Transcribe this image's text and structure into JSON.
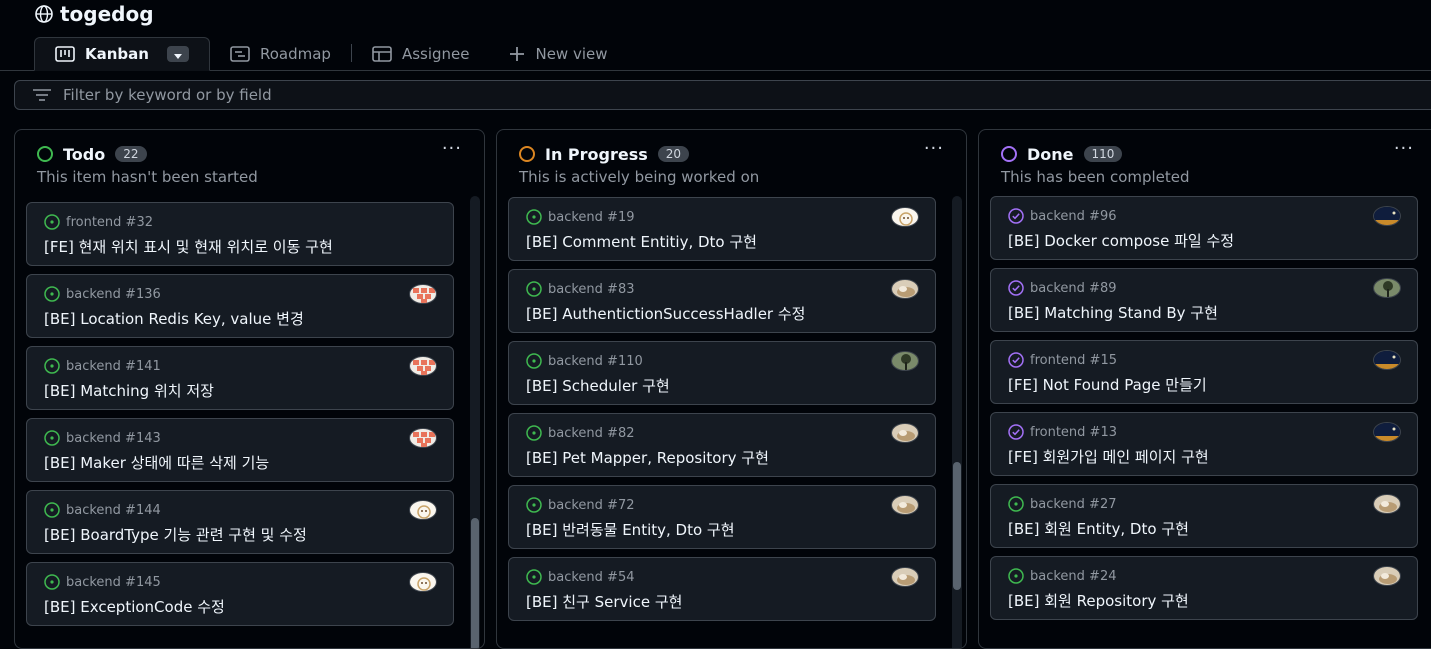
{
  "project": {
    "title": "togedog",
    "icon": "globe-icon"
  },
  "views": [
    {
      "label": "Kanban",
      "icon": "board-icon",
      "active": true
    },
    {
      "label": "Roadmap",
      "icon": "roadmap-icon",
      "active": false
    },
    {
      "label": "Assignee",
      "icon": "table-icon",
      "active": false
    },
    {
      "label": "New view",
      "icon": "plus-icon",
      "active": false
    }
  ],
  "filter": {
    "placeholder": "Filter by keyword or by field",
    "icon": "filter-icon"
  },
  "columns": [
    {
      "title": "Todo",
      "count": "22",
      "description": "This item hasn't been started",
      "status_color": "#3fb950",
      "menu": "···",
      "cards": [
        {
          "meta": "frontend #32",
          "title": "[FE] 현재 위치 표시 및 현재 위치로 이동 구현",
          "state": "open",
          "avatar": ""
        },
        {
          "meta": "backend #136",
          "title": "[BE] Location Redis Key, value 변경",
          "state": "open",
          "avatar": "pixel"
        },
        {
          "meta": "backend #141",
          "title": "[BE] Matching 위치 저장",
          "state": "open",
          "avatar": "pixel"
        },
        {
          "meta": "backend #143",
          "title": "[BE] Maker 상태에 따른 삭제 기능",
          "state": "open",
          "avatar": "pixel"
        },
        {
          "meta": "backend #144",
          "title": "[BE] BoardType 기능 관련 구현 및 수정",
          "state": "open",
          "avatar": "dog"
        },
        {
          "meta": "backend #145",
          "title": "[BE] ExceptionCode 수정",
          "state": "open",
          "avatar": "dog"
        }
      ]
    },
    {
      "title": "In Progress",
      "count": "20",
      "description": "This is actively being worked on",
      "status_color": "#db8622",
      "menu": "···",
      "cards": [
        {
          "meta": "backend #19",
          "title": "[BE] Comment Entitiy, Dto 구현",
          "state": "open",
          "avatar": "dog"
        },
        {
          "meta": "backend #83",
          "title": "[BE] AuthentictionSuccessHadler 수정",
          "state": "open",
          "avatar": "cat"
        },
        {
          "meta": "backend #110",
          "title": "[BE] Scheduler 구현",
          "state": "open",
          "avatar": "tree"
        },
        {
          "meta": "backend #82",
          "title": "[BE] Pet Mapper, Repository 구현",
          "state": "open",
          "avatar": "cat"
        },
        {
          "meta": "backend #72",
          "title": "[BE] 반려동물 Entity, Dto 구현",
          "state": "open",
          "avatar": "cat"
        },
        {
          "meta": "backend #54",
          "title": "[BE] 친구 Service 구현",
          "state": "open",
          "avatar": "cat"
        }
      ]
    },
    {
      "title": "Done",
      "count": "110",
      "description": "This has been completed",
      "status_color": "#a371f7",
      "menu": "···",
      "cards": [
        {
          "meta": "backend #96",
          "title": "[BE] Docker compose 파일 수정",
          "state": "closed",
          "avatar": "night"
        },
        {
          "meta": "backend #89",
          "title": "[BE] Matching Stand By 구현",
          "state": "closed",
          "avatar": "tree"
        },
        {
          "meta": "frontend #15",
          "title": "[FE] Not Found Page 만들기",
          "state": "closed",
          "avatar": "night"
        },
        {
          "meta": "frontend #13",
          "title": "[FE] 회원가입 메인 페이지 구현",
          "state": "closed",
          "avatar": "night"
        },
        {
          "meta": "backend #27",
          "title": "[BE] 회원 Entity, Dto 구현",
          "state": "open",
          "avatar": "cat"
        },
        {
          "meta": "backend #24",
          "title": "[BE] 회원 Repository 구현",
          "state": "open",
          "avatar": "cat"
        }
      ]
    }
  ],
  "colors": {
    "open": "#3fb950",
    "closed": "#a371f7",
    "background": "#010409",
    "card": "#151b23"
  }
}
